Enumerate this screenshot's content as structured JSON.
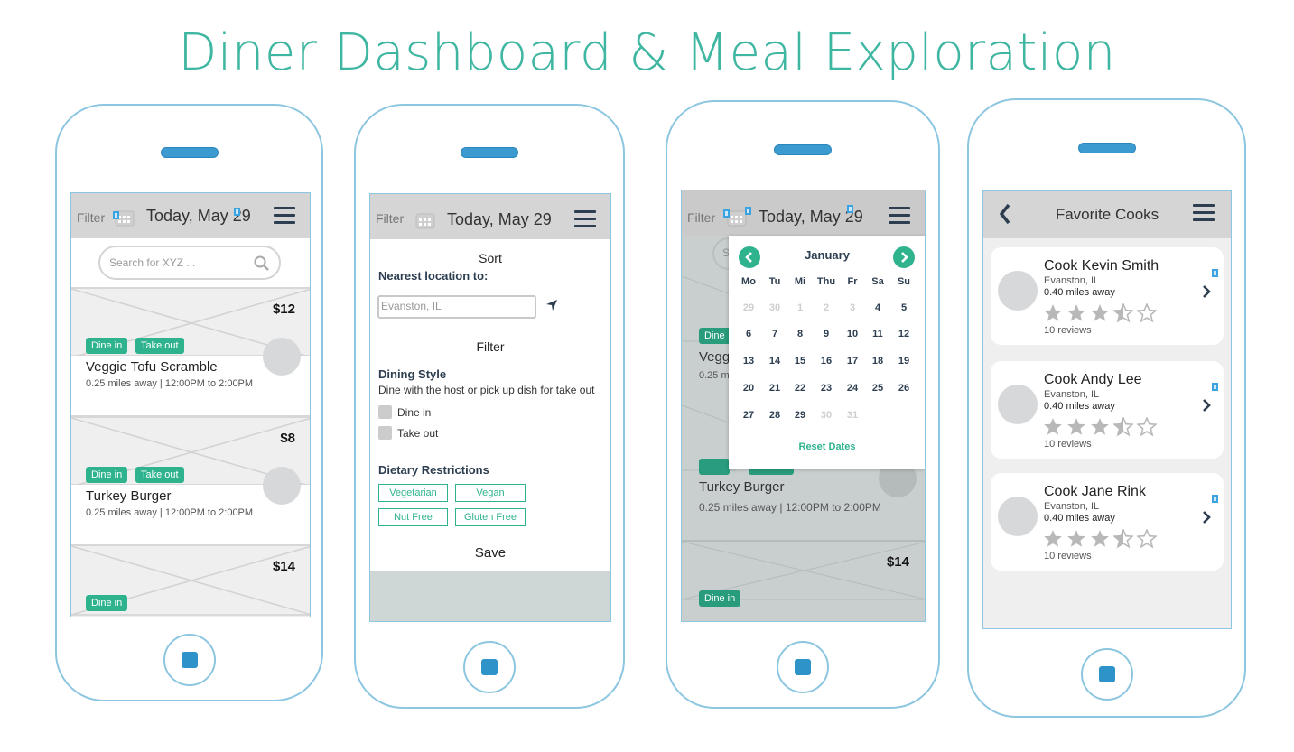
{
  "page": {
    "title": "Diner Dashboard & Meal Exploration"
  },
  "colors": {
    "accent": "#2fb38f",
    "title": "#3fb6a1",
    "phone_border": "#8cc6e0",
    "button": "#2e93c9"
  },
  "dashboard": {
    "filter_label": "Filter",
    "date": "Today, May 29",
    "search_placeholder": "Search for XYZ ...",
    "meals": [
      {
        "price": "$12",
        "tags": [
          "Dine in",
          "Take out"
        ],
        "name": "Veggie Tofu Scramble",
        "meta": "0.25 miles away |  12:00PM to 2:00PM"
      },
      {
        "price": "$8",
        "tags": [
          "Dine in",
          "Take out"
        ],
        "name": "Turkey Burger",
        "meta": "0.25 miles away |  12:00PM to 2:00PM"
      },
      {
        "price": "$14",
        "tags": [
          "Dine in"
        ]
      }
    ]
  },
  "filter_screen": {
    "filter_label": "Filter",
    "date": "Today, May 29",
    "sort_label": "Sort",
    "nearest_label": "Nearest location to:",
    "location_placeholder": "Evanston, IL",
    "filter_heading": "Filter",
    "dining_style_heading": "Dining Style",
    "dining_style_desc": "Dine with the host or pick up dish for take out",
    "options": [
      "Dine in",
      "Take out"
    ],
    "dietary_heading": "Dietary Restrictions",
    "dietary_pills": [
      "Vegetarian",
      "Vegan",
      "Nut Free",
      "Gluten Free"
    ],
    "save_label": "Save"
  },
  "calendar_screen": {
    "filter_label": "Filter",
    "date": "Today, May 29",
    "month": "January",
    "weekdays": [
      "Mo",
      "Tu",
      "Mi",
      "Thu",
      "Fr",
      "Sa",
      "Su"
    ],
    "days": [
      [
        {
          "d": "29",
          "dim": true
        },
        {
          "d": "30",
          "dim": true
        },
        {
          "d": "1",
          "dim": true
        },
        {
          "d": "2",
          "dim": true
        },
        {
          "d": "3",
          "dim": true
        },
        {
          "d": "4"
        },
        {
          "d": "5"
        }
      ],
      [
        {
          "d": "6"
        },
        {
          "d": "7"
        },
        {
          "d": "8"
        },
        {
          "d": "9"
        },
        {
          "d": "10"
        },
        {
          "d": "11"
        },
        {
          "d": "12"
        }
      ],
      [
        {
          "d": "13"
        },
        {
          "d": "14"
        },
        {
          "d": "15"
        },
        {
          "d": "16"
        },
        {
          "d": "17"
        },
        {
          "d": "18"
        },
        {
          "d": "19"
        }
      ],
      [
        {
          "d": "20"
        },
        {
          "d": "21"
        },
        {
          "d": "22"
        },
        {
          "d": "23"
        },
        {
          "d": "24"
        },
        {
          "d": "25"
        },
        {
          "d": "26"
        }
      ],
      [
        {
          "d": "27"
        },
        {
          "d": "28"
        },
        {
          "d": "29"
        },
        {
          "d": "30",
          "dim": true
        },
        {
          "d": "31",
          "dim": true
        }
      ]
    ],
    "reset_label": "Reset Dates",
    "behind": {
      "meal2_name": "Turkey Burger",
      "meal2_meta": "0.25 miles away |  12:00PM to 2:00PM",
      "meal3_price": "$14",
      "meal3_tag": "Dine in",
      "partial_tag": "Dine",
      "partial_name": "Vegg",
      "partial_meta": "0.25 m",
      "partial_search": "S"
    }
  },
  "favorites_screen": {
    "title": "Favorite Cooks",
    "cooks": [
      {
        "name": "Cook Kevin Smith",
        "location": "Evanston, IL",
        "distance": "0.40 miles away",
        "rating": 3.5,
        "reviews": "10 reviews"
      },
      {
        "name": "Cook Andy Lee",
        "location": "Evanston, IL",
        "distance": "0.40 miles away",
        "rating": 3.5,
        "reviews": "10 reviews"
      },
      {
        "name": "Cook Jane Rink",
        "location": "Evanston, IL",
        "distance": "0.40 miles away",
        "rating": 3.5,
        "reviews": "10 reviews"
      }
    ]
  }
}
